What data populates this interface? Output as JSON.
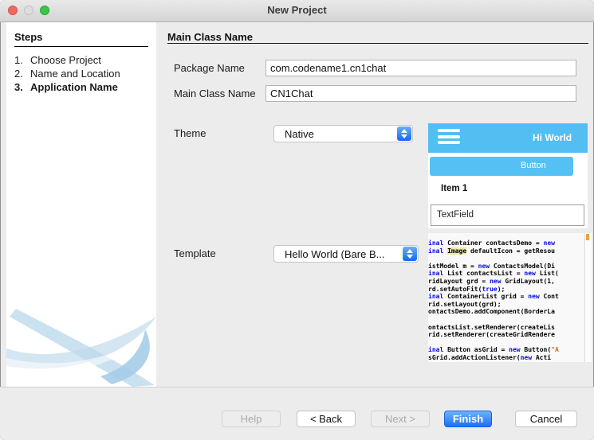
{
  "window": {
    "title": "New Project"
  },
  "sidebar": {
    "title": "Steps",
    "steps": [
      {
        "num": "1.",
        "label": "Choose Project",
        "active": false
      },
      {
        "num": "2.",
        "label": "Name and Location",
        "active": false
      },
      {
        "num": "3.",
        "label": "Application Name",
        "active": true
      }
    ]
  },
  "main": {
    "title": "Main Class Name",
    "fields": {
      "package_name": {
        "label": "Package Name",
        "value": "com.codename1.cn1chat"
      },
      "main_class_name": {
        "label": "Main Class Name",
        "value": "CN1Chat"
      },
      "theme": {
        "label": "Theme",
        "value": "Native"
      },
      "template": {
        "label": "Template",
        "value": "Hello World (Bare B..."
      }
    }
  },
  "preview": {
    "accent_color": "#52bef2",
    "titlebar_text": "Hi World",
    "button_label": "Button",
    "item_label": "Item 1",
    "textfield_value": "TextField"
  },
  "code_preview": {
    "lines": [
      [
        {
          "t": "inal ",
          "c": "kw"
        },
        {
          "t": "Container contactsDemo = ",
          "c": "p"
        },
        {
          "t": "new",
          "c": "kw"
        }
      ],
      [
        {
          "t": "inal ",
          "c": "kw"
        },
        {
          "t": "Image",
          "c": "hl"
        },
        {
          "t": " defaultIcon = getResou",
          "c": "p"
        }
      ],
      [],
      [
        {
          "t": "istModel m = ",
          "c": "p"
        },
        {
          "t": "new ",
          "c": "kw"
        },
        {
          "t": "ContactsModel(Di",
          "c": "p"
        }
      ],
      [
        {
          "t": "inal ",
          "c": "kw"
        },
        {
          "t": "List contactsList = ",
          "c": "p"
        },
        {
          "t": "new ",
          "c": "kw"
        },
        {
          "t": "List(",
          "c": "p"
        }
      ],
      [
        {
          "t": "ridLayout grd = ",
          "c": "p"
        },
        {
          "t": "new ",
          "c": "kw"
        },
        {
          "t": "GridLayout(1,",
          "c": "p"
        }
      ],
      [
        {
          "t": "rd.setAutoFit(",
          "c": "p"
        },
        {
          "t": "true",
          "c": "kw"
        },
        {
          "t": ");",
          "c": "p"
        }
      ],
      [
        {
          "t": "inal ",
          "c": "kw"
        },
        {
          "t": "ContainerList grid = ",
          "c": "p"
        },
        {
          "t": "new ",
          "c": "kw"
        },
        {
          "t": "Cont",
          "c": "p"
        }
      ],
      [
        {
          "t": "rid.setLayout(grd);",
          "c": "p"
        }
      ],
      [
        {
          "t": "ontactsDemo.addComponent(BorderLa",
          "c": "p"
        }
      ],
      [],
      [
        {
          "t": "ontactsList.setRenderer(createLis",
          "c": "p"
        }
      ],
      [
        {
          "t": "rid.setRenderer(createGridRendere",
          "c": "p"
        }
      ],
      [],
      [
        {
          "t": "inal ",
          "c": "kw"
        },
        {
          "t": "Button asGrid = ",
          "c": "p"
        },
        {
          "t": "new ",
          "c": "kw"
        },
        {
          "t": "Button(",
          "c": "p"
        },
        {
          "t": "\"A",
          "c": "str"
        }
      ],
      [
        {
          "t": "sGrid.addActionListener(",
          "c": "p"
        },
        {
          "t": "new ",
          "c": "kw"
        },
        {
          "t": "Acti",
          "c": "p"
        }
      ]
    ]
  },
  "footer": {
    "buttons": {
      "help": {
        "label": "Help",
        "enabled": false
      },
      "back": {
        "label": "< Back",
        "enabled": true
      },
      "next": {
        "label": "Next >",
        "enabled": false
      },
      "finish": {
        "label": "Finish",
        "enabled": true,
        "default": true
      },
      "cancel": {
        "label": "Cancel",
        "enabled": true
      }
    }
  }
}
